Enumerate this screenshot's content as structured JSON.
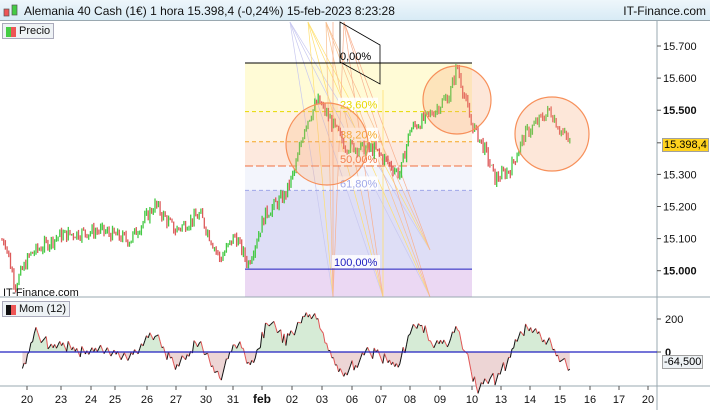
{
  "header": {
    "title": "Alemania 40 Cash (1€) 1 hora 15.398,4 (-0,24%) 15-feb-2023 8:23:28",
    "brand": "IT-Finance.com",
    "logo_icon": "candlestick-icon"
  },
  "price_panel": {
    "legend": "Precio",
    "watermark": "IT-Finance.com",
    "last_price": "15.398,4",
    "y_ticks": [
      {
        "label": "15.700",
        "v": 15700,
        "bold": false
      },
      {
        "label": "15.600",
        "v": 15600,
        "bold": false
      },
      {
        "label": "15.500",
        "v": 15500,
        "bold": true
      },
      {
        "label": "15.300",
        "v": 15300,
        "bold": false
      },
      {
        "label": "15.200",
        "v": 15200,
        "bold": false
      },
      {
        "label": "15.100",
        "v": 15100,
        "bold": false
      },
      {
        "label": "15.000",
        "v": 15000,
        "bold": true
      }
    ],
    "fibonacci": {
      "high": 15647,
      "low": 15005,
      "levels": [
        {
          "label": "0,00%",
          "r": 0,
          "color": "#000000"
        },
        {
          "label": "23,60%",
          "r": 0.236,
          "color": "#e8d800"
        },
        {
          "label": "38,20%",
          "r": 0.382,
          "color": "#f5a623"
        },
        {
          "label": "50,00%",
          "r": 0.5,
          "color": "#f07040"
        },
        {
          "label": "61,80%",
          "r": 0.618,
          "color": "#a0a8e8"
        },
        {
          "label": "100,00%",
          "r": 1,
          "color": "#2020c0"
        }
      ]
    }
  },
  "momentum_panel": {
    "legend": "Mom (12)",
    "last_value": "-64,500",
    "y_ticks": [
      {
        "label": "200",
        "v": 200
      },
      {
        "label": "0",
        "v": 0
      }
    ]
  },
  "x_axis": {
    "labels": [
      "20",
      "23",
      "24",
      "25",
      "26",
      "27",
      "30",
      "31",
      "feb",
      "02",
      "03",
      "06",
      "07",
      "08",
      "09",
      "10",
      "13",
      "14",
      "15",
      "16",
      "17",
      "20"
    ]
  },
  "chart_data": {
    "type": "candlestick",
    "title": "Alemania 40 Cash (1€) 1 hora",
    "ylim": [
      14920,
      15780
    ],
    "anchor_prices": [
      15095,
      14955,
      15050,
      15110,
      15125,
      15095,
      15205,
      15125,
      15175,
      15035,
      15110,
      15020,
      15175,
      15235,
      15315,
      15455,
      15530,
      15470,
      15390,
      15375,
      15300,
      15440,
      15485,
      15550,
      15640,
      15470,
      15375,
      15285,
      15315,
      15425,
      15500,
      15440,
      15398
    ],
    "colors": {
      "up": "#44c944",
      "down": "#dd5a5a"
    }
  }
}
